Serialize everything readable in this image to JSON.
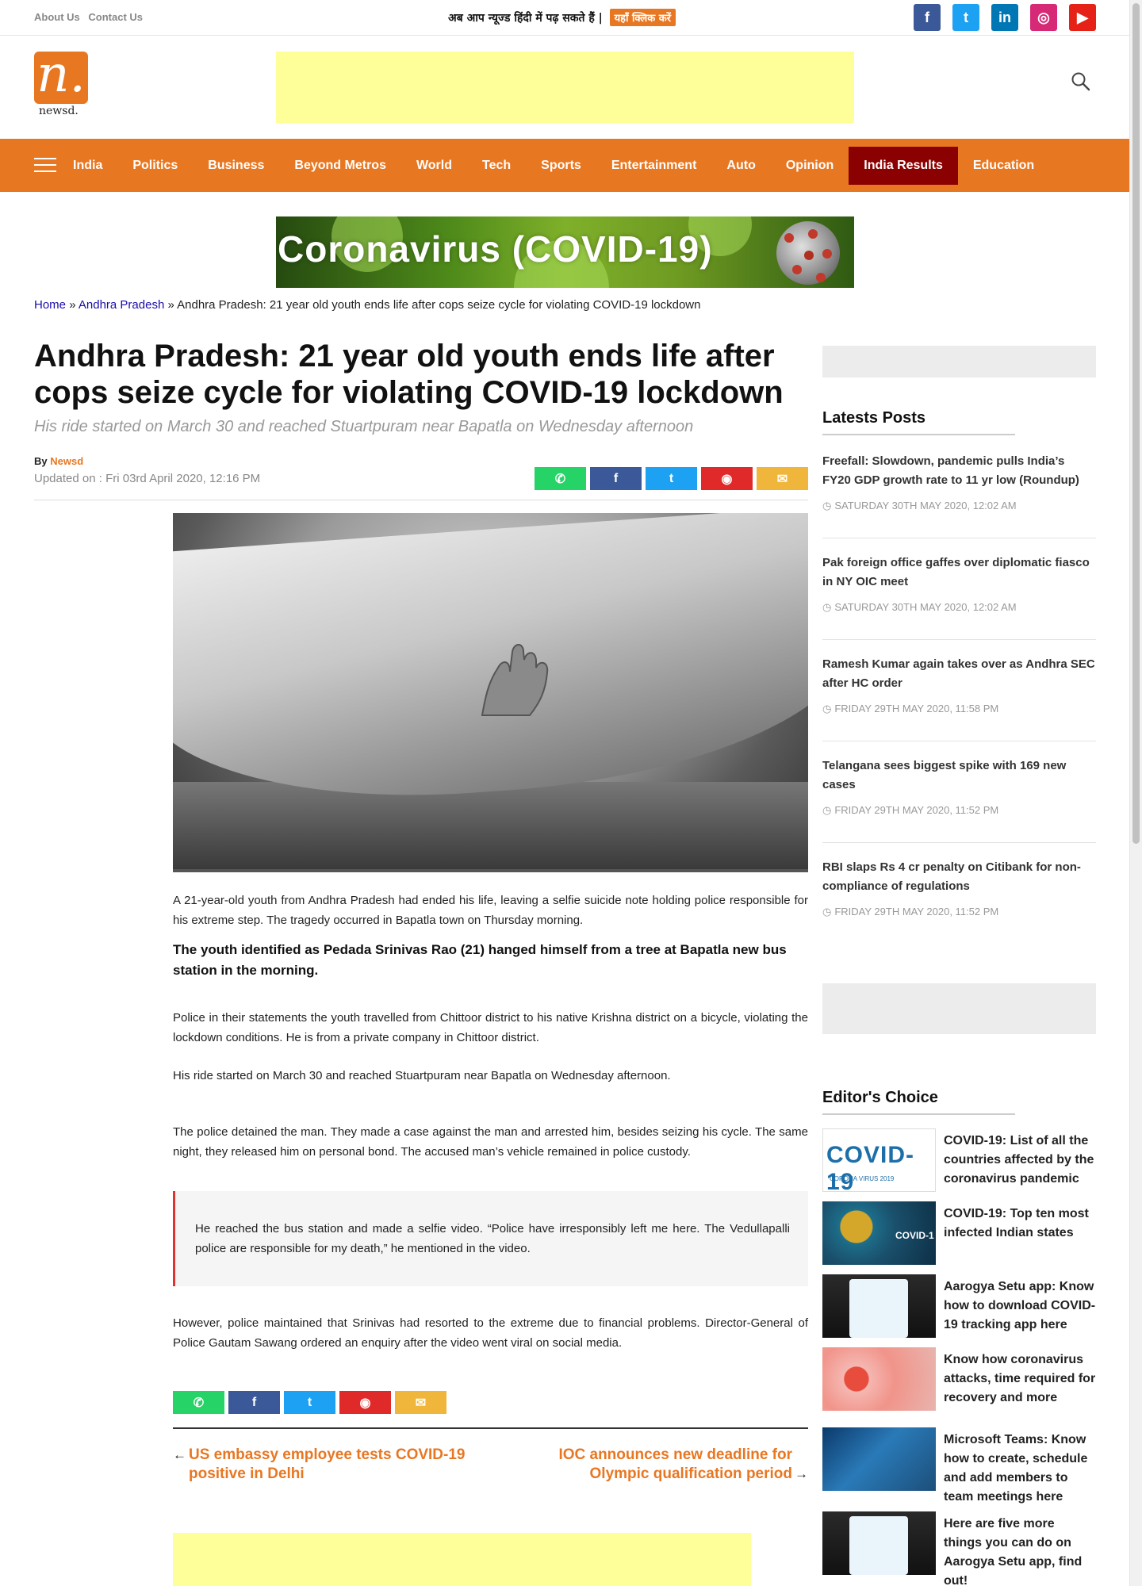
{
  "topbar": {
    "links": [
      "About Us",
      "Contact Us"
    ],
    "hindi_text": "अब आप न्यूज्ड हिंदी में पढ़ सकते हैं |",
    "hindi_button": "यहाँ क्लिक करें",
    "socials": [
      {
        "name": "facebook",
        "glyph": "f",
        "color": "#3b5998"
      },
      {
        "name": "twitter",
        "glyph": "t",
        "color": "#1da1f2"
      },
      {
        "name": "linkedin",
        "glyph": "in",
        "color": "#0077b5"
      },
      {
        "name": "instagram",
        "glyph": "◎",
        "color": "#d62976"
      },
      {
        "name": "youtube",
        "glyph": "▶",
        "color": "#e62117"
      }
    ]
  },
  "logo": {
    "letter": "n.",
    "word": "newsd."
  },
  "nav": {
    "items": [
      "India",
      "Politics",
      "Business",
      "Beyond Metros",
      "World",
      "Tech",
      "Sports",
      "Entertainment",
      "Auto",
      "Opinion",
      "India Results",
      "Education"
    ],
    "active": "India Results",
    "accent": "#e87722",
    "active_color": "#8b0000"
  },
  "banner": {
    "text": "Coronavirus  (COVID-19)"
  },
  "breadcrumb": {
    "home": "Home",
    "section": "Andhra Pradesh",
    "current": "Andhra Pradesh: 21 year old youth ends life after cops seize cycle for violating COVID-19 lockdown",
    "sep": "»"
  },
  "article": {
    "title": "Andhra Pradesh: 21 year old youth ends life after cops seize cycle for violating COVID-19 lockdown",
    "subtitle": "His ride started on March 30 and reached Stuartpuram near Bapatla on Wednesday afternoon",
    "by_label": "By",
    "author": "Newsd",
    "updated": "Updated on : Fri 03rd April 2020, 12:16 PM",
    "paragraphs": [
      "A 21-year-old youth from Andhra Pradesh had ended his life, leaving a selfie suicide note holding police responsible for his extreme step. The tragedy occurred in Bapatla town on Thursday morning.",
      "The youth identified as Pedada Srinivas Rao (21) hanged himself from a tree at Bapatla new bus station in the morning.",
      "Police in their statements the youth travelled from Chittoor district to his native Krishna district on a bicycle, violating the lockdown conditions. He is from a private company in Chittoor district.",
      "His ride started on March 30 and reached Stuartpuram near Bapatla on Wednesday afternoon.",
      "The police detained the man. They made a case against the man and arrested him, besides seizing his cycle. The same night, they released him on personal bond. The accused man’s vehicle remained in police custody.",
      "However, police maintained that Srinivas had resorted to the extreme due to financial problems. Director-General of Police Gautam Sawang ordered an enquiry after the video went viral on social media."
    ],
    "quote": "He reached the bus station and made a selfie video. “Police have irresponsibly left me here. The Vedullapalli police are responsible for my death,” he mentioned in the video.",
    "share": [
      {
        "name": "whatsapp",
        "glyph": "✆",
        "color": "#25d366"
      },
      {
        "name": "facebook",
        "glyph": "f",
        "color": "#3b5998"
      },
      {
        "name": "twitter",
        "glyph": "t",
        "color": "#1da1f2"
      },
      {
        "name": "reddit",
        "glyph": "◉",
        "color": "#e02a2a"
      },
      {
        "name": "email",
        "glyph": "✉",
        "color": "#f0b63c"
      }
    ],
    "prev": "US embassy employee tests COVID-19 positive in Delhi",
    "next": "IOC announces new deadline for Olympic qualification period"
  },
  "sidebar": {
    "latest_heading": "Latests Posts",
    "latest": [
      {
        "title": "Freefall: Slowdown, pandemic pulls India’s FY20 GDP growth rate to 11 yr low (Roundup)",
        "date": "SATURDAY 30TH MAY 2020, 12:02 AM"
      },
      {
        "title": "Pak foreign office gaffes over diplomatic fiasco in NY OIC meet",
        "date": "SATURDAY 30TH MAY 2020, 12:02 AM"
      },
      {
        "title": "Ramesh Kumar again takes over as Andhra SEC after HC order",
        "date": "FRIDAY 29TH MAY 2020, 11:58 PM"
      },
      {
        "title": "Telangana sees biggest spike with 169 new cases",
        "date": "FRIDAY 29TH MAY 2020, 11:52 PM"
      },
      {
        "title": "RBI slaps Rs 4 cr penalty on Citibank for non-compliance of regulations",
        "date": "FRIDAY 29TH MAY 2020, 11:52 PM"
      }
    ],
    "editors_heading": "Editor's Choice",
    "editors": [
      {
        "title": "COVID-19: List of all the countries affected by the coronavirus pandemic",
        "thumb_text": "COVID-19",
        "thumb_small": "CORONA VIRUS 2019"
      },
      {
        "title": "COVID-19: Top ten most infected Indian states",
        "thumb_text": "COVID-1"
      },
      {
        "title": "Aarogya Setu app: Know how to download COVID-19 tracking app here"
      },
      {
        "title": "Know how coronavirus attacks, time required for recovery and more"
      },
      {
        "title": "Microsoft Teams: Know how to create, schedule and add members to team meetings here"
      },
      {
        "title": "Here are five more things you can do on Aarogya Setu app, find out!"
      }
    ]
  }
}
